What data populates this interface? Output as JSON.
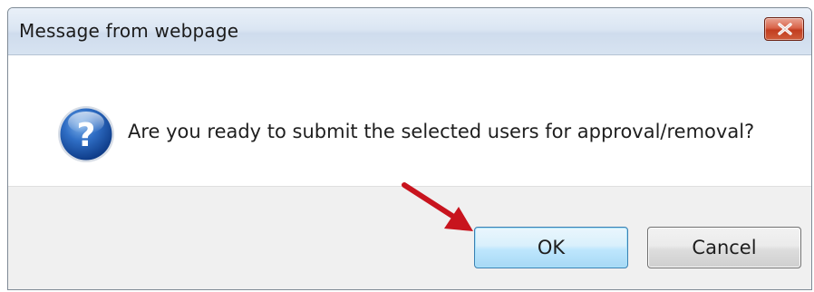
{
  "dialog": {
    "title": "Message from webpage",
    "message": "Are you ready to submit the selected users for approval/removal?",
    "icon": "question-icon",
    "close_icon": "close-icon"
  },
  "buttons": {
    "ok_label": "OK",
    "cancel_label": "Cancel"
  },
  "annotation": {
    "arrow_icon": "red-arrow-icon",
    "arrow_color": "#c8141e"
  },
  "colors": {
    "close_button": "#c9432a",
    "ok_border": "#3c7fb1",
    "footer_background": "#f0f0f0"
  }
}
